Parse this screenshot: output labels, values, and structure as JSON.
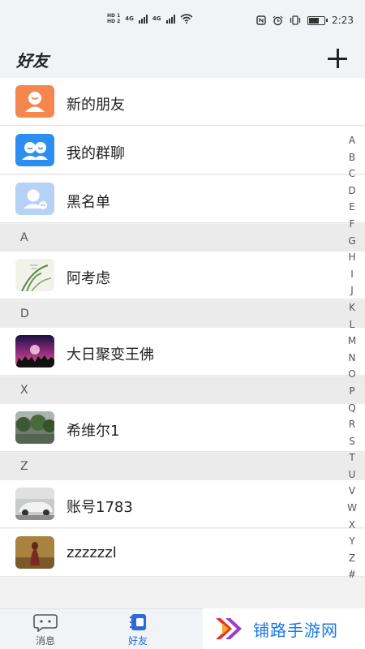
{
  "status_bar": {
    "hd1": "HD 1",
    "hd2": "HD 2",
    "net1": "4G",
    "net2": "4G",
    "time": "2:23",
    "battery_level": 0.7
  },
  "header": {
    "title": "好友"
  },
  "fixed_items": [
    {
      "name": "新的朋友"
    },
    {
      "name": "我的群聊"
    },
    {
      "name": "黑名单"
    }
  ],
  "sections": [
    {
      "letter": "A",
      "contacts": [
        {
          "name": "阿考虑"
        }
      ]
    },
    {
      "letter": "D",
      "contacts": [
        {
          "name": "大日聚变王佛"
        }
      ]
    },
    {
      "letter": "X",
      "contacts": [
        {
          "name": "希维尔1"
        }
      ]
    },
    {
      "letter": "Z",
      "contacts": [
        {
          "name": "账号1783"
        },
        {
          "name": "zzzzzzl"
        }
      ]
    }
  ],
  "index_letters": [
    "A",
    "B",
    "C",
    "D",
    "E",
    "F",
    "G",
    "H",
    "I",
    "J",
    "K",
    "L",
    "M",
    "N",
    "O",
    "P",
    "Q",
    "R",
    "S",
    "T",
    "U",
    "V",
    "W",
    "X",
    "Y",
    "Z",
    "#"
  ],
  "tabs": [
    {
      "label": "消息"
    },
    {
      "label": "好友"
    }
  ],
  "brand": {
    "text": "铺路手游网"
  },
  "colors": {
    "accent": "#1e6fe0",
    "new_friend_icon": "#f4864e",
    "group_icon": "#2b8ef0",
    "blacklist_icon": "#b7d2f7"
  }
}
